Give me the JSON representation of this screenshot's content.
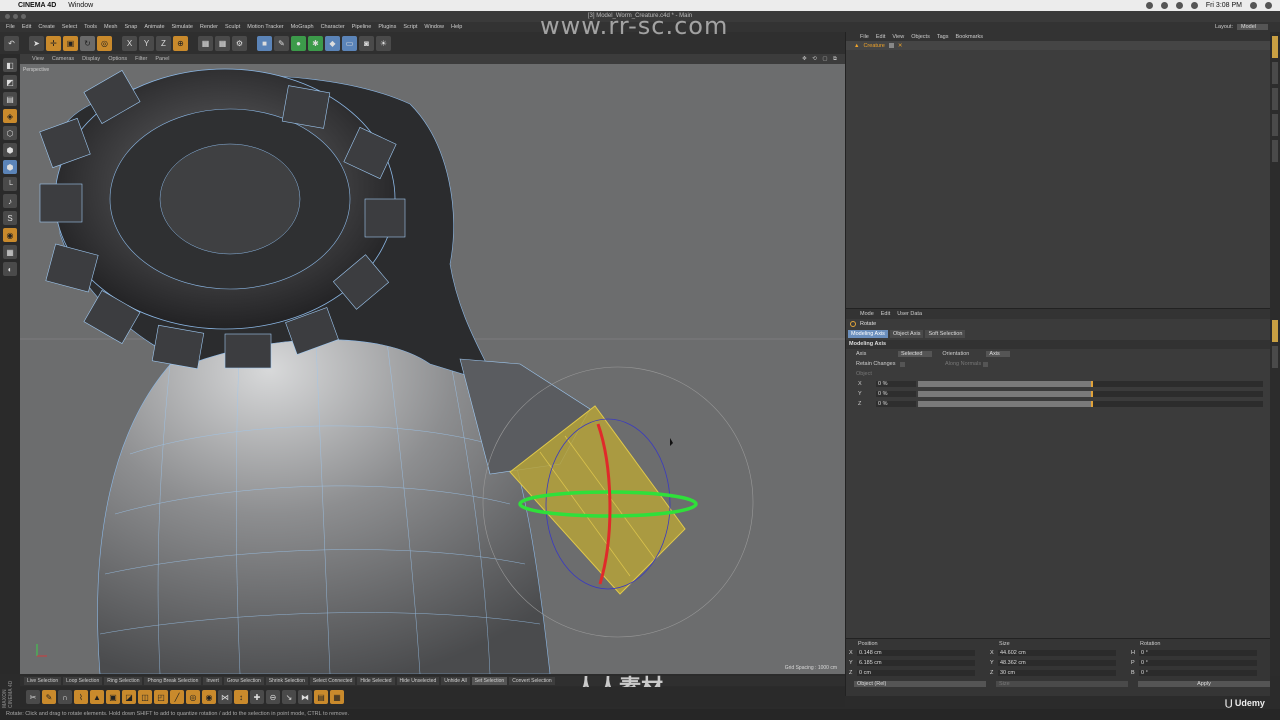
{
  "mac_menubar": {
    "app_name": "CINEMA 4D",
    "menu": "Window",
    "clock": "Fri 3:08 PM"
  },
  "window": {
    "title": "[3] Model_Worm_Creature.c4d * - Main"
  },
  "app_menu": {
    "items": [
      "File",
      "Edit",
      "Create",
      "Select",
      "Tools",
      "Mesh",
      "Snap",
      "Animate",
      "Simulate",
      "Render",
      "Sculpt",
      "Motion Tracker",
      "MoGraph",
      "Character",
      "Pipeline",
      "Plugins",
      "Script",
      "Window",
      "Help"
    ],
    "layout_label": "Layout:",
    "layout_value": "Model"
  },
  "toolbar": {
    "undo_icon": "undo-icon",
    "axis_x": "X",
    "axis_y": "Y",
    "axis_z": "Z"
  },
  "viewport": {
    "menu": [
      "View",
      "Cameras",
      "Display",
      "Options",
      "Filter",
      "Panel"
    ],
    "nav_icons": "✥ ⟲ ▢ ⧉",
    "label": "Perspective",
    "grid_spacing": "Grid Spacing : 1000 cm"
  },
  "watermark": {
    "top": "www.rr-sc.com",
    "bottom": "人人素材"
  },
  "selection_bar": {
    "items": [
      "Live Selection",
      "Loop Selection",
      "Ring Selection",
      "Phong Break Selection",
      "Invert",
      "Grow Selection",
      "Shrink Selection",
      "Select Connected",
      "Hide Selected",
      "Hide Unselected",
      "Unhide All",
      "Set Selection",
      "Convert Selection"
    ]
  },
  "maxon_label": "MAXON CINEMA 4D",
  "status_text": "Rotate: Click and drag to rotate elements. Hold down SHIFT to add to quantize rotation / add to the selection in point mode, CTRL to remove.",
  "object_manager": {
    "menu": [
      "File",
      "Edit",
      "View",
      "Objects",
      "Tags",
      "Bookmarks"
    ],
    "object_name": "Creature"
  },
  "attribute_manager": {
    "menu": [
      "Mode",
      "Edit",
      "User Data"
    ],
    "tool_name": "Rotate",
    "tabs": [
      "Modeling Axis",
      "Object Axis",
      "Soft Selection"
    ],
    "section": "Modeling Axis",
    "axis_label": "Axis",
    "axis_value": "Selected",
    "orientation_label": "Orientation",
    "orientation_value": "Axis",
    "retain_changes": "Retain Changes",
    "along_normals": "Along Normals",
    "object_label": "Object",
    "rows": [
      {
        "axis": "X",
        "value": "0 %",
        "level": 0.5
      },
      {
        "axis": "Y",
        "value": "0 %",
        "level": 0.5
      },
      {
        "axis": "Z",
        "value": "0 %",
        "level": 0.5
      }
    ]
  },
  "coordinates": {
    "headers": [
      "Position",
      "Size",
      "Rotation"
    ],
    "rows": [
      {
        "pk": "X",
        "pv": "0.148 cm",
        "sk": "X",
        "sv": "44.602 cm",
        "rk": "H",
        "rv": "0 °"
      },
      {
        "pk": "Y",
        "pv": "6.185 cm",
        "sk": "Y",
        "sv": "48.362 cm",
        "rk": "P",
        "rv": "0 °"
      },
      {
        "pk": "Z",
        "pv": "0 cm",
        "sk": "Z",
        "sv": "30 cm",
        "rk": "B",
        "rv": "0 °"
      }
    ],
    "mode": "Object (Rel)",
    "size_mode": "Size",
    "apply": "Apply"
  },
  "branding": "Udemy"
}
